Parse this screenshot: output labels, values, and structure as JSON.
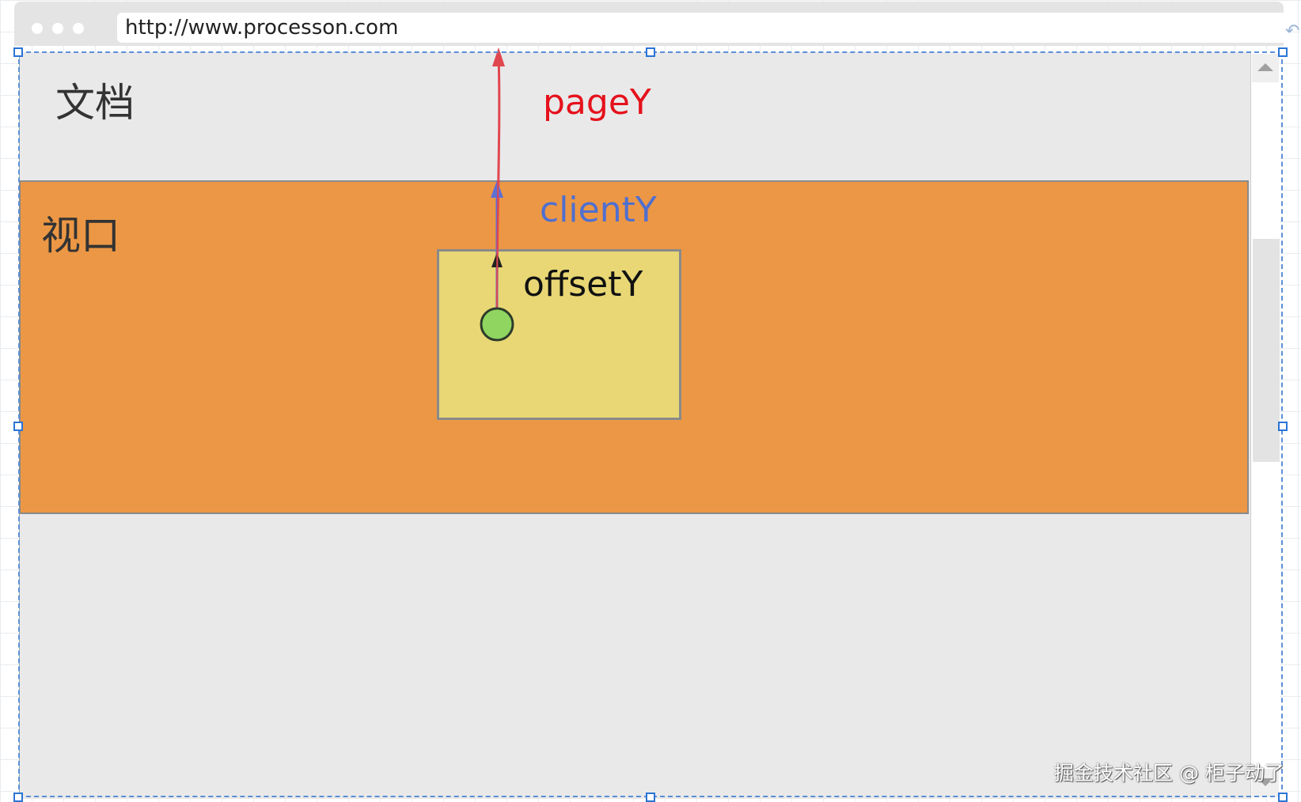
{
  "browser": {
    "url": "http://www.processon.com"
  },
  "labels": {
    "document": "文档",
    "viewport": "视口",
    "pageY": "pageY",
    "clientY": "clientY",
    "offsetY": "offsetY"
  },
  "colors": {
    "pageY": "#e5121c",
    "clientY": "#4f6fd0",
    "offsetY": "#111111",
    "viewport_fill": "#ec9745",
    "target_fill": "#e8d774",
    "point_fill": "#8fd560",
    "document_fill": "#e9e9ea"
  },
  "watermark": "掘金技术社区 @ 柜子动了"
}
